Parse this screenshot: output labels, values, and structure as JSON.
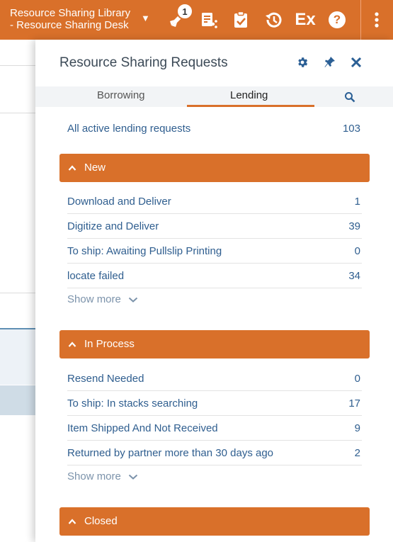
{
  "header": {
    "location_line1": "Resource Sharing Library",
    "location_line2": "- Resource Sharing Desk",
    "location_caret": "▼",
    "notification_count": "1",
    "ex_label": "Ex",
    "help_label": "?",
    "brand_color": "#d9702a"
  },
  "panel": {
    "title": "Resource Sharing Requests",
    "tabs": [
      {
        "label": "Borrowing",
        "active": false
      },
      {
        "label": "Lending",
        "active": true
      }
    ],
    "all_active": {
      "label": "All active lending requests",
      "count": "103"
    },
    "sections": [
      {
        "title": "New",
        "items": [
          {
            "label": "Download and Deliver",
            "count": "1"
          },
          {
            "label": "Digitize and Deliver",
            "count": "39"
          },
          {
            "label": "To ship: Awaiting Pullslip Printing",
            "count": "0"
          },
          {
            "label": "locate failed",
            "count": "34"
          }
        ],
        "show_more": "Show more"
      },
      {
        "title": "In Process",
        "items": [
          {
            "label": "Resend Needed",
            "count": "0"
          },
          {
            "label": "To ship: In stacks searching",
            "count": "17"
          },
          {
            "label": "Item Shipped And Not Received",
            "count": "9"
          },
          {
            "label": "Returned by partner more than 30 days ago",
            "count": "2"
          }
        ],
        "show_more": "Show more"
      },
      {
        "title": "Closed",
        "items": []
      }
    ]
  },
  "colors": {
    "accent": "#d9702a",
    "link": "#2f5e8f",
    "icon_blue": "#2b5f95"
  }
}
